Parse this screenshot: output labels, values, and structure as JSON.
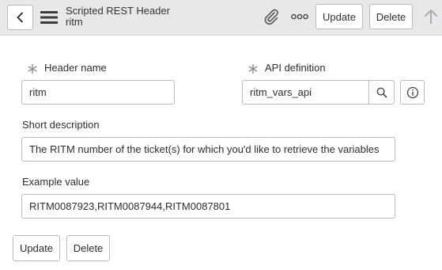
{
  "header": {
    "title": "Scripted REST Header",
    "subtitle": "ritm",
    "update_label": "Update",
    "delete_label": "Delete"
  },
  "form": {
    "header_name": {
      "label": "Header name",
      "value": "ritm",
      "required": true
    },
    "api_definition": {
      "label": "API definition",
      "value": "ritm_vars_api",
      "required": true
    },
    "short_description": {
      "label": "Short description",
      "value": "The RITM number of the ticket(s) for which you'd like to retrieve the variables"
    },
    "example_value": {
      "label": "Example value",
      "value": "RITM0087923,RITM0087944,RITM0087801"
    }
  },
  "footer": {
    "update_label": "Update",
    "delete_label": "Delete"
  },
  "icons": [
    "chevron-left-icon",
    "hamburger-menu-icon",
    "paperclip-icon",
    "more-options-icon",
    "arrow-up-icon",
    "required-asterisk-icon",
    "search-icon",
    "info-icon"
  ]
}
